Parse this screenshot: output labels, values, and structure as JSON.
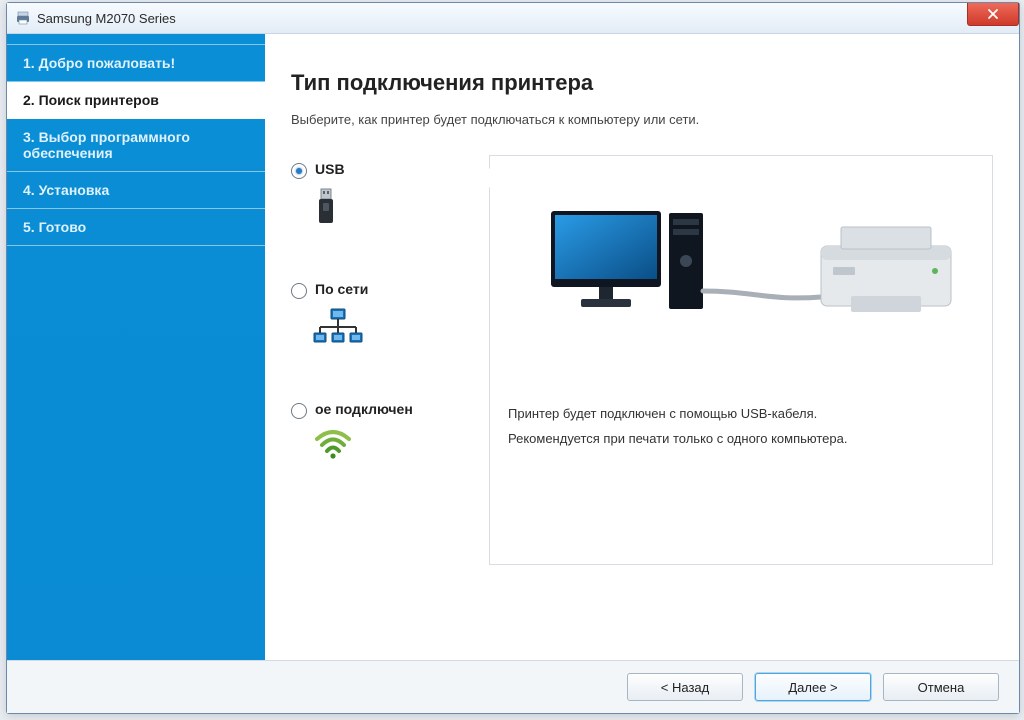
{
  "window": {
    "title": "Samsung M2070 Series"
  },
  "colors": {
    "sidebar": "#0a8ed6",
    "accent": "#2b7bbf"
  },
  "sidebar": {
    "steps": [
      {
        "label": "1. Добро пожаловать!"
      },
      {
        "label": "2. Поиск принтеров"
      },
      {
        "label": "3. Выбор программного обеспечения"
      },
      {
        "label": "4. Установка"
      },
      {
        "label": "5. Готово"
      }
    ],
    "active_index": 1
  },
  "page": {
    "title": "Тип подключения принтера",
    "subtitle": "Выберите, как принтер будет подключаться к компьютеру или сети."
  },
  "options": [
    {
      "id": "usb",
      "label": "USB",
      "selected": true
    },
    {
      "id": "network",
      "label": "По сети",
      "selected": false
    },
    {
      "id": "wifi",
      "label": "ое подключен",
      "selected": false
    }
  ],
  "preview": {
    "line1": "Принтер будет подключен с помощью USB-кабеля.",
    "line2": "Рекомендуется при печати только с одного компьютера."
  },
  "footer": {
    "back": "< Назад",
    "next": "Далее >",
    "cancel": "Отмена"
  }
}
